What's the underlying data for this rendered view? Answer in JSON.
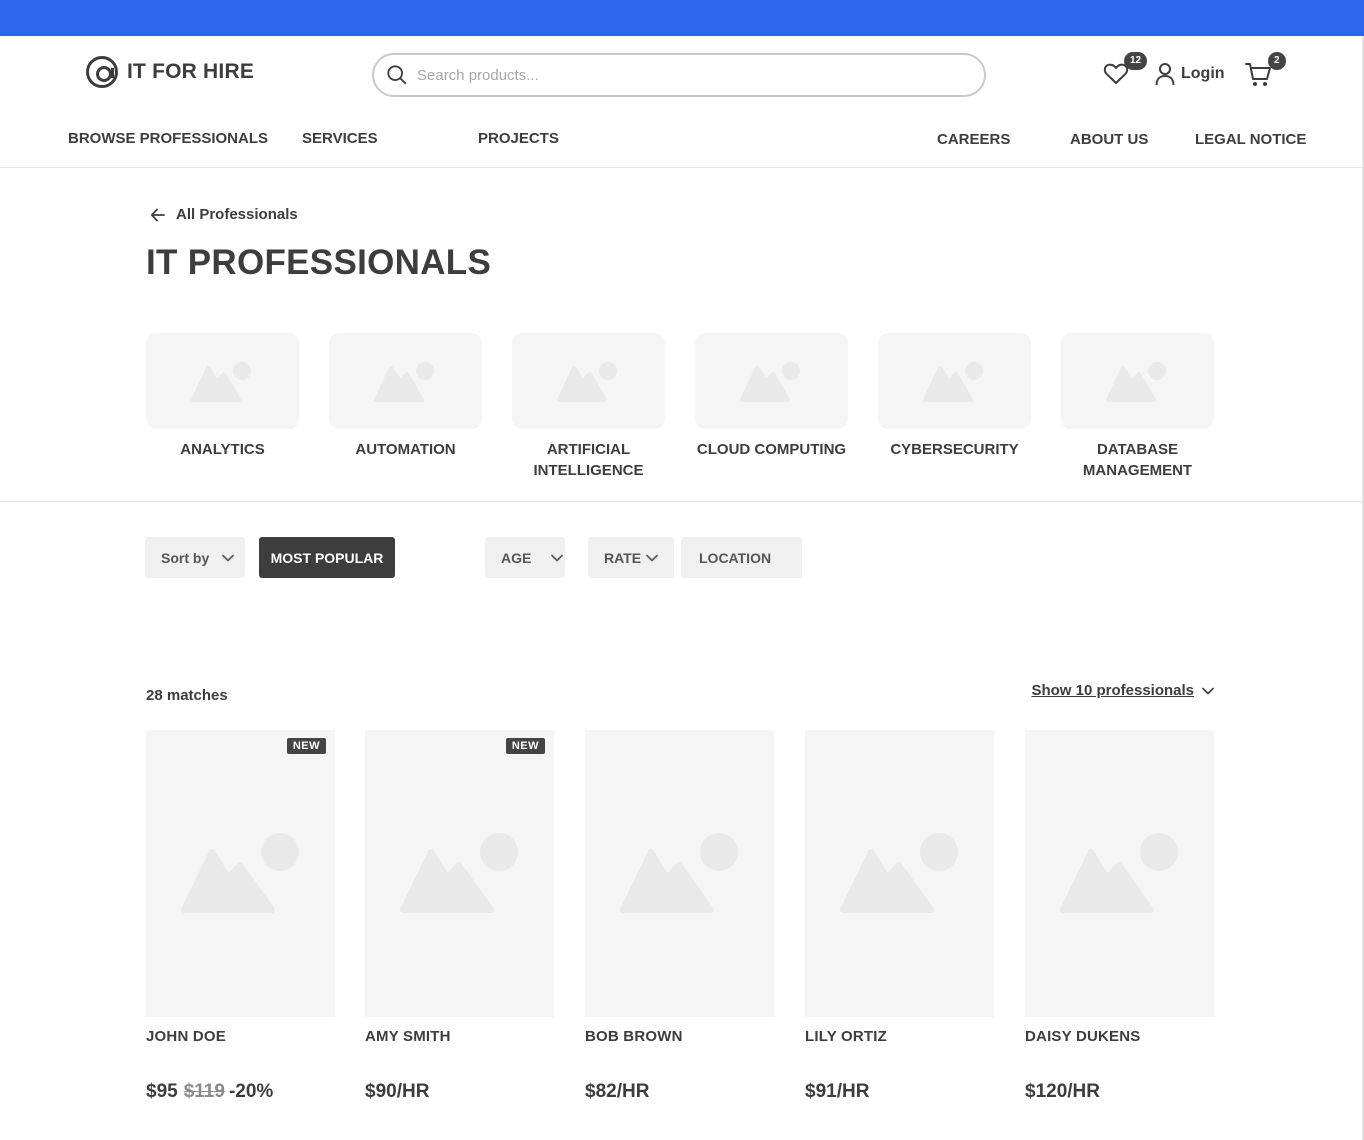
{
  "brand": {
    "name": "IT FOR HIRE"
  },
  "search": {
    "placeholder": "Search products..."
  },
  "header": {
    "wishlist_count": "12",
    "login_label": "Login",
    "cart_count": "2"
  },
  "nav": {
    "items": [
      "BROWSE PROFESSIONALS",
      "SERVICES",
      "PROJECTS",
      "CAREERS",
      "ABOUT US",
      "LEGAL NOTICE"
    ]
  },
  "breadcrumb": {
    "back_label": "All Professionals"
  },
  "page": {
    "title": "IT PROFESSIONALS"
  },
  "categories": [
    {
      "label": "ANALYTICS"
    },
    {
      "label": "AUTOMATION"
    },
    {
      "label": "ARTIFICIAL INTELLIGENCE"
    },
    {
      "label": "CLOUD COMPUTING"
    },
    {
      "label": "CYBERSECURITY"
    },
    {
      "label": "DATABASE MANAGEMENT"
    }
  ],
  "filters": {
    "sort_label": "Sort by",
    "active_sort": "MOST POPULAR",
    "age": "AGE",
    "rate": "RATE",
    "location": "LOCATION"
  },
  "results": {
    "matches": "28 matches",
    "show_label": "Show 10 professionals"
  },
  "professionals": [
    {
      "name": "JOHN DOE",
      "badge": "NEW",
      "price": "$95",
      "old_price": "$119",
      "discount": "-20%"
    },
    {
      "name": "AMY SMITH",
      "badge": "NEW",
      "price": "$90/HR"
    },
    {
      "name": "BOB BROWN",
      "price": "$82/HR"
    },
    {
      "name": "LILY ORTIZ",
      "price": "$91/HR"
    },
    {
      "name": "DAISY DUKENS",
      "price": "$120/HR"
    }
  ],
  "colors": {
    "topbar": "#2b67e8",
    "text": "#3d3d3d",
    "placeholder_bg": "#f5f5f5",
    "dark_button": "#3d3d3d"
  },
  "icons": [
    "search-icon",
    "heart-icon",
    "user-icon",
    "cart-icon",
    "arrow-left-icon",
    "chevron-down-icon",
    "image-placeholder-icon"
  ]
}
